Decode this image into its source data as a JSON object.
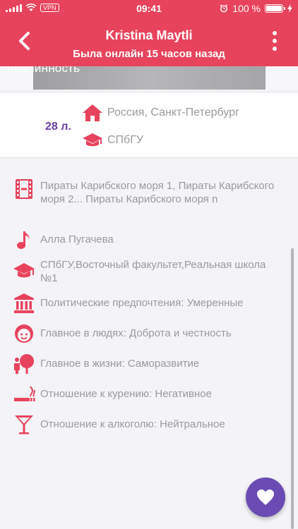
{
  "status_bar": {
    "time": "09:41",
    "vpn": "VPN",
    "battery": "100 %"
  },
  "header": {
    "title": "Kristina Maytli",
    "subtitle": "Была онлайн 15 часов назад"
  },
  "photo": {
    "caption": "подлинность"
  },
  "profile": {
    "age": "28 л.",
    "location": "Россия, Санкт-Петербург",
    "university": "СПбГУ"
  },
  "details": [
    {
      "icon": "film-icon",
      "text": "Пираты Карибского моря 1, Пираты Карибского моря 2... Пираты Карибского моря n"
    },
    {
      "icon": "music-note-icon",
      "text": "Алла Пугачева"
    },
    {
      "icon": "graduation-cap-icon",
      "text": "СПбГУ,Восточный факультет,Реальная школа №1"
    },
    {
      "icon": "government-building-icon",
      "text": "Политические предпочтения: Умеренные"
    },
    {
      "icon": "face-icon",
      "text": "Главное в людях: Доброта и честность"
    },
    {
      "icon": "tree-person-icon",
      "text": "Главное в жизни: Саморазвитие"
    },
    {
      "icon": "smoking-icon",
      "text": "Отношение к курению: Негативное"
    },
    {
      "icon": "cocktail-glass-icon",
      "text": "Отношение к алкоголю: Нейтральное"
    }
  ],
  "colors": {
    "accent": "#e8435d",
    "purple": "#6a4bb3",
    "age": "#6a3fa0",
    "text_muted": "#9a9a9e"
  }
}
